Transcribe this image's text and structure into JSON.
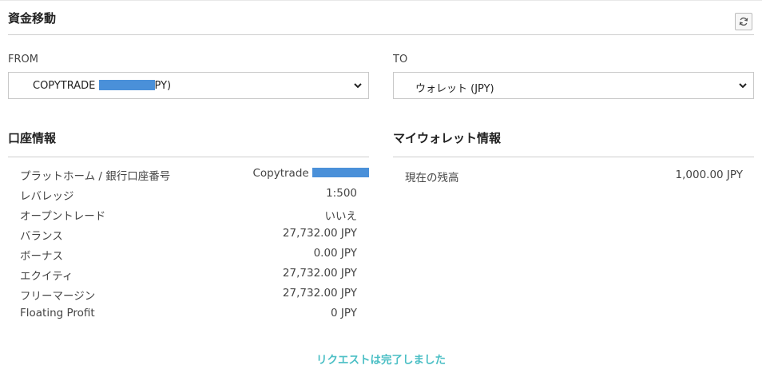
{
  "header": {
    "title": "資金移動"
  },
  "colors": {
    "accent": "#4bbfc5",
    "redaction": "#4a90d9"
  },
  "from": {
    "label": "FROM",
    "selected_prefix": "COPYTRADE ",
    "selected_suffix": "PY)"
  },
  "to": {
    "label": "TO",
    "selected": "ウォレット (JPY)"
  },
  "account_info": {
    "title": "口座情報",
    "rows": [
      {
        "label": "プラットホーム / 銀行口座番号",
        "value": "Copytrade "
      },
      {
        "label": "レバレッジ",
        "value": "1:500"
      },
      {
        "label": "オープントレード",
        "value": "いいえ"
      },
      {
        "label": "バランス",
        "value": "27,732.00 JPY"
      },
      {
        "label": "ボーナス",
        "value": "0.00 JPY"
      },
      {
        "label": "エクイティ",
        "value": "27,732.00 JPY"
      },
      {
        "label": "フリーマージン",
        "value": "27,732.00 JPY"
      },
      {
        "label": "Floating Profit",
        "value": "0 JPY"
      }
    ]
  },
  "wallet_info": {
    "title": "マイウォレット情報",
    "balance_label": "現在の残高",
    "balance_value": "1,000.00 JPY"
  },
  "status": {
    "message": "リクエストは完了しました"
  }
}
